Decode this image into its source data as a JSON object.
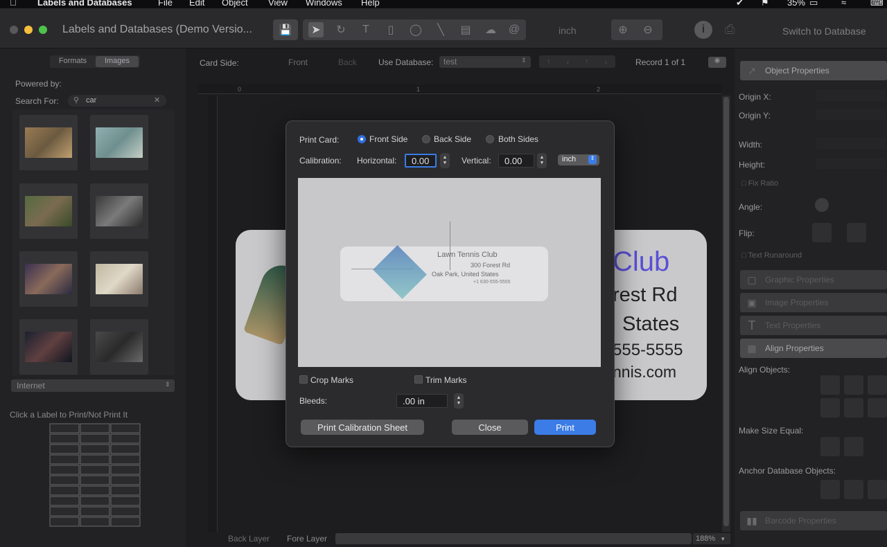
{
  "menubar": {
    "app": "Labels and Databases",
    "items": [
      "File",
      "Edit",
      "Object",
      "View",
      "Windows",
      "Help"
    ],
    "battery": "35%"
  },
  "toolbar": {
    "title": "Labels and Databases (Demo Versio...",
    "units": "inch",
    "switch": "Switch to Database"
  },
  "left": {
    "tabs": [
      "Formats",
      "Images"
    ],
    "powered_by": "Powered by:",
    "search_label": "Search For:",
    "search_value": "car",
    "source": "Internet",
    "click_hint": "Click a Label to Print/Not Print It"
  },
  "canvas": {
    "card_side_label": "Card Side:",
    "front": "Front",
    "back": "Back",
    "use_db_label": "Use Database:",
    "db_value": "test",
    "record": "Record 1 of 1",
    "ruler": [
      "0",
      "1",
      "2"
    ],
    "card_lines": [
      "Club",
      "rest Rd",
      "States",
      "555-5555",
      "nnis.com"
    ],
    "back_layer": "Back Layer",
    "fore_layer": "Fore Layer",
    "zoom": "188%"
  },
  "right": {
    "object_props": "Object Properties",
    "origin_x": "Origin X:",
    "origin_y": "Origin Y:",
    "width": "Width:",
    "height": "Height:",
    "fix_ratio": "Fix Ratio",
    "angle": "Angle:",
    "flip": "Flip:",
    "text_runaround": "Text Runaround",
    "graphic_props": "Graphic Properties",
    "image_props": "Image Properties",
    "text_props": "Text Properties",
    "align_props": "Align Properties",
    "align_objects": "Align Objects:",
    "make_size_equal": "Make Size Equal:",
    "anchor_db": "Anchor Database Objects:",
    "barcode_props": "Barcode Properties"
  },
  "dialog": {
    "print_card_label": "Print Card:",
    "options": [
      "Front Side",
      "Back Side",
      "Both Sides"
    ],
    "selected": 0,
    "calibration_label": "Calibration:",
    "horizontal_label": "Horizontal:",
    "horizontal_value": "0.00",
    "vertical_label": "Vertical:",
    "vertical_value": "0.00",
    "unit": "inch",
    "preview_lines": [
      "Lawn Tennis Club",
      "300 Forest Rd",
      "Oak Park, United States",
      "+1 630-555-5555"
    ],
    "crop_marks": "Crop Marks",
    "trim_marks": "Trim Marks",
    "bleeds_label": "Bleeds:",
    "bleeds_value": ".00 in",
    "calib_sheet_btn": "Print Calibration Sheet",
    "close_btn": "Close",
    "print_btn": "Print"
  },
  "colors": {
    "accent": "#3b7ce6",
    "card_text": "#5a4fd6"
  }
}
